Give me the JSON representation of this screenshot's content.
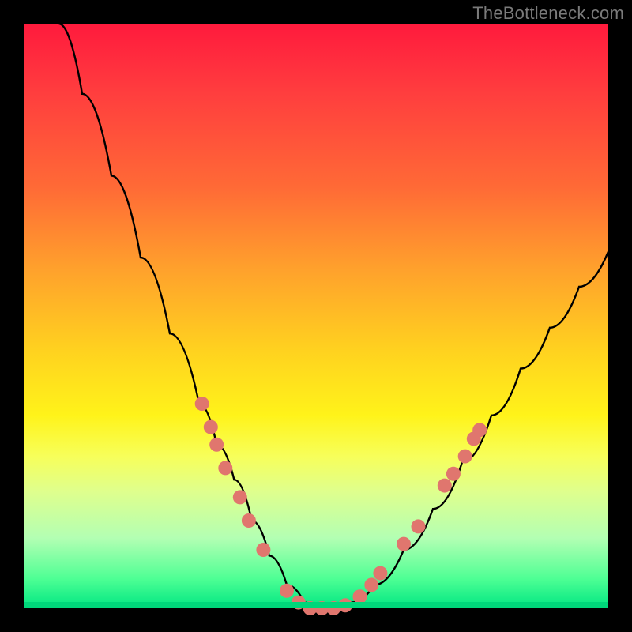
{
  "watermark": "TheBottleneck.com",
  "chart_data": {
    "type": "line",
    "title": "",
    "xlabel": "",
    "ylabel": "",
    "xlim": [
      0,
      100
    ],
    "ylim": [
      0,
      100
    ],
    "grid": false,
    "legend": false,
    "background_gradient": {
      "direction": "vertical",
      "stops": [
        {
          "pos": 0,
          "color": "#ff1a3d"
        },
        {
          "pos": 42,
          "color": "#ffa12c"
        },
        {
          "pos": 67,
          "color": "#fff31a"
        },
        {
          "pos": 100,
          "color": "#00e682"
        }
      ]
    },
    "series": [
      {
        "name": "bottleneck-curve",
        "color": "#000000",
        "x": [
          6,
          10,
          15,
          20,
          25,
          30,
          33,
          36,
          39,
          42,
          45,
          48,
          50,
          53,
          56,
          60,
          65,
          70,
          75,
          80,
          85,
          90,
          95,
          100
        ],
        "y": [
          100,
          88,
          74,
          60,
          47,
          35,
          28,
          22,
          15,
          9,
          4,
          1,
          0,
          0,
          1,
          4,
          10,
          17,
          25,
          33,
          41,
          48,
          55,
          61
        ]
      }
    ],
    "markers": {
      "name": "highlighted-points",
      "color": "#e0766e",
      "radius": 9,
      "points": [
        {
          "x": 30.5,
          "y": 35
        },
        {
          "x": 32.0,
          "y": 31
        },
        {
          "x": 33.0,
          "y": 28
        },
        {
          "x": 34.5,
          "y": 24
        },
        {
          "x": 37.0,
          "y": 19
        },
        {
          "x": 38.5,
          "y": 15
        },
        {
          "x": 41.0,
          "y": 10
        },
        {
          "x": 45.0,
          "y": 3
        },
        {
          "x": 47.0,
          "y": 1
        },
        {
          "x": 49.0,
          "y": 0
        },
        {
          "x": 51.0,
          "y": 0
        },
        {
          "x": 53.0,
          "y": 0
        },
        {
          "x": 55.0,
          "y": 0.5
        },
        {
          "x": 57.5,
          "y": 2
        },
        {
          "x": 59.5,
          "y": 4
        },
        {
          "x": 61.0,
          "y": 6
        },
        {
          "x": 65.0,
          "y": 11
        },
        {
          "x": 67.5,
          "y": 14
        },
        {
          "x": 72.0,
          "y": 21
        },
        {
          "x": 73.5,
          "y": 23
        },
        {
          "x": 75.5,
          "y": 26
        },
        {
          "x": 77.0,
          "y": 29
        },
        {
          "x": 78.0,
          "y": 30.5
        }
      ]
    }
  }
}
